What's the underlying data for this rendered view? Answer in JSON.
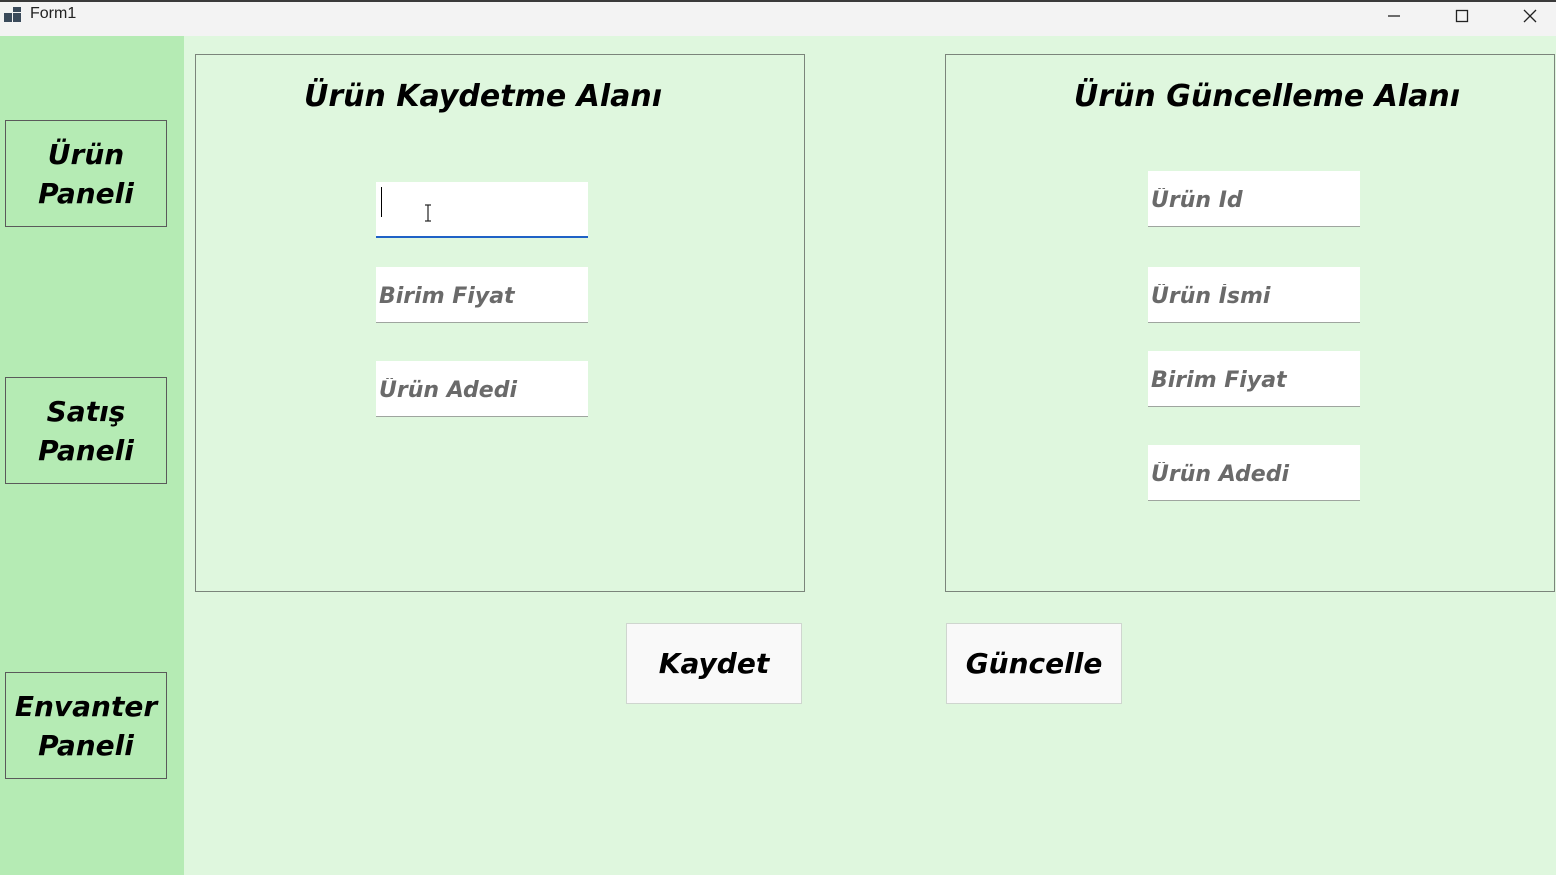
{
  "window": {
    "title": "Form1",
    "icon": "app-window-icon",
    "controls": [
      "minimize-icon",
      "maximize-icon",
      "close-icon"
    ]
  },
  "sidebar": {
    "items": [
      {
        "label": "Ürün\nPaneli"
      },
      {
        "label": "Satış\nPaneli"
      },
      {
        "label": "Envanter\nPaneli"
      }
    ]
  },
  "save_area": {
    "title": "Ürün Kaydetme Alanı",
    "fields": [
      {
        "placeholder": "",
        "value": "",
        "focused": true
      },
      {
        "placeholder": "Birim Fiyat",
        "value": ""
      },
      {
        "placeholder": "Ürün Adedi",
        "value": ""
      }
    ]
  },
  "update_area": {
    "title": "Ürün Güncelleme Alanı",
    "fields": [
      {
        "placeholder": "Ürün Id",
        "value": ""
      },
      {
        "placeholder": "Ürün İsmi",
        "value": ""
      },
      {
        "placeholder": "Birim Fiyat",
        "value": ""
      },
      {
        "placeholder": "Ürün Adedi",
        "value": ""
      }
    ]
  },
  "buttons": {
    "save_label": "Kaydet",
    "update_label": "Güncelle"
  },
  "colors": {
    "form_background": "#dff7de",
    "sidebar_background": "#b5ebb4",
    "focus_underline": "#1f62c6"
  }
}
